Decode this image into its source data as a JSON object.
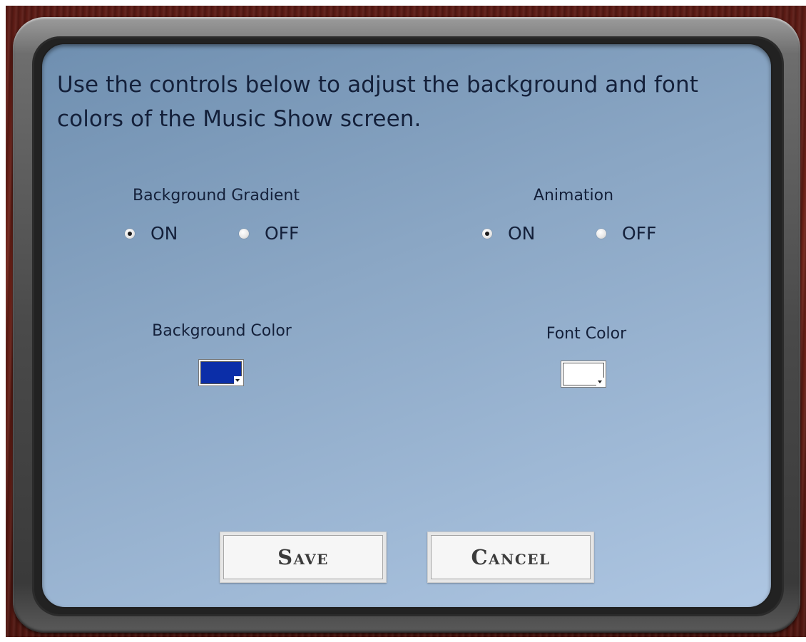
{
  "dialog": {
    "intro_text": "Use the controls below to adjust the background and font colors of the Music Show screen."
  },
  "background_gradient": {
    "label": "Background Gradient",
    "options": [
      {
        "label": "ON",
        "checked": true
      },
      {
        "label": "OFF",
        "checked": false
      }
    ]
  },
  "animation": {
    "label": "Animation",
    "options": [
      {
        "label": "ON",
        "checked": true
      },
      {
        "label": "OFF",
        "checked": false
      }
    ]
  },
  "background_color": {
    "label": "Background Color",
    "value": "#0b2ea8"
  },
  "font_color": {
    "label": "Font Color",
    "value": "#ffffff"
  },
  "buttons": {
    "save": "Save",
    "cancel": "Cancel"
  }
}
